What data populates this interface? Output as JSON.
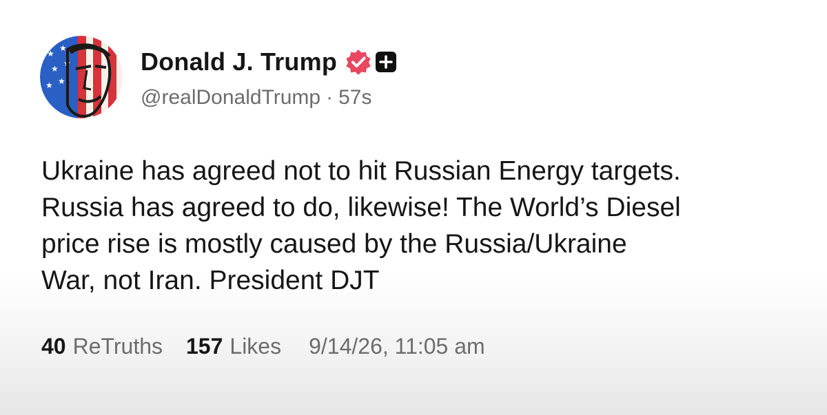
{
  "post": {
    "author": {
      "display_name": "Donald J. Trump",
      "handle": "@realDonaldTrump",
      "separator": "·",
      "age": "57s",
      "verified_icon": "verified-check-icon",
      "badge_icon": "plus-badge-icon",
      "verified_color": "#e8475f"
    },
    "text": "Ukraine has agreed not to hit Russian Energy targets.\nRussia has agreed to do, likewise! The World’s Diesel\nprice rise is mostly caused by the Russia/Ukraine\nWar, not Iran. President DJT",
    "stats": {
      "retruths_count": "40",
      "retruths_label": "ReTruths",
      "likes_count": "157",
      "likes_label": "Likes",
      "timestamp": "9/14/26, 11:05 am"
    }
  }
}
